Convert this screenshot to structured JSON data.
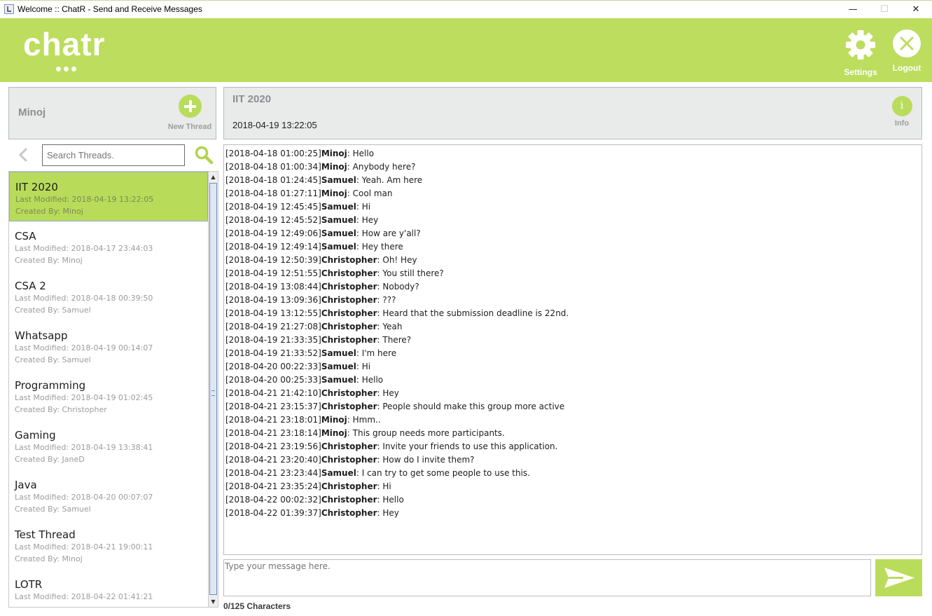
{
  "window": {
    "title": "Welcome :: ChatR - Send and Receive Messages",
    "minimize_glyph": "—",
    "maximize_glyph": "☐",
    "close_glyph": "✕"
  },
  "header": {
    "logo": "chatr",
    "settings_label": "Settings",
    "logout_label": "Logout",
    "accent_color": "#bcdd5d"
  },
  "user_panel": {
    "username": "Minoj",
    "new_thread_label": "New Thread"
  },
  "search": {
    "placeholder": "Search Threads."
  },
  "threads": [
    {
      "name": "IIT 2020",
      "modified": "Last Modified: 2018-04-19 13:22:05",
      "creator": "Created By: Minoj",
      "selected": true
    },
    {
      "name": "CSA",
      "modified": "Last Modified: 2018-04-17 23:44:03",
      "creator": "Created By: Minoj"
    },
    {
      "name": "CSA 2",
      "modified": "Last Modified: 2018-04-18 00:39:50",
      "creator": "Created By: Samuel"
    },
    {
      "name": "Whatsapp",
      "modified": "Last Modified: 2018-04-19 00:14:07",
      "creator": "Created By: Samuel"
    },
    {
      "name": "Programming",
      "modified": "Last Modified: 2018-04-19 01:02:45",
      "creator": "Created By: Christopher"
    },
    {
      "name": "Gaming",
      "modified": "Last Modified: 2018-04-19 13:38:41",
      "creator": "Created By: JaneD"
    },
    {
      "name": "Java",
      "modified": "Last Modified: 2018-04-20 00:07:07",
      "creator": "Created By: Samuel"
    },
    {
      "name": "Test Thread",
      "modified": "Last Modified: 2018-04-21 19:00:11",
      "creator": "Created By: Minoj"
    },
    {
      "name": "LOTR",
      "modified": "Last Modified: 2018-04-22 01:41:21",
      "creator": ""
    }
  ],
  "active_thread": {
    "title": "IIT 2020",
    "date": "2018-04-19 13:22:05",
    "info_label": "Info"
  },
  "messages": [
    {
      "time": "[2018-04-18 01:00:25]",
      "sender": "Minoj",
      "text": ": Hello"
    },
    {
      "time": "[2018-04-18 01:00:34]",
      "sender": "Minoj",
      "text": ": Anybody here?"
    },
    {
      "time": "[2018-04-18 01:24:45]",
      "sender": "Samuel",
      "text": ": Yeah. Am here"
    },
    {
      "time": "[2018-04-18 01:27:11]",
      "sender": "Minoj",
      "text": ": Cool man"
    },
    {
      "time": "[2018-04-19 12:45:45]",
      "sender": "Samuel",
      "text": ": Hi"
    },
    {
      "time": "[2018-04-19 12:45:52]",
      "sender": "Samuel",
      "text": ": Hey"
    },
    {
      "time": "[2018-04-19 12:49:06]",
      "sender": "Samuel",
      "text": ": How are y'all?"
    },
    {
      "time": "[2018-04-19 12:49:14]",
      "sender": "Samuel",
      "text": ": Hey there"
    },
    {
      "time": "[2018-04-19 12:50:39]",
      "sender": "Christopher",
      "text": ": Oh! Hey"
    },
    {
      "time": "[2018-04-19 12:51:55]",
      "sender": "Christopher",
      "text": ": You still there?"
    },
    {
      "time": "[2018-04-19 13:08:44]",
      "sender": "Christopher",
      "text": ": Nobody?"
    },
    {
      "time": "[2018-04-19 13:09:36]",
      "sender": "Christopher",
      "text": ": ???"
    },
    {
      "time": "[2018-04-19 13:12:55]",
      "sender": "Christopher",
      "text": ": Heard that the submission deadline is 22nd."
    },
    {
      "time": "[2018-04-19 21:27:08]",
      "sender": "Christopher",
      "text": ": Yeah"
    },
    {
      "time": "[2018-04-19 21:33:35]",
      "sender": "Christopher",
      "text": ": There?"
    },
    {
      "time": "[2018-04-19 21:33:52]",
      "sender": "Samuel",
      "text": ": I'm here"
    },
    {
      "time": "[2018-04-20 00:22:33]",
      "sender": "Samuel",
      "text": ": Hi"
    },
    {
      "time": "[2018-04-20 00:25:33]",
      "sender": "Samuel",
      "text": ": Hello"
    },
    {
      "time": "[2018-04-21 21:42:10]",
      "sender": "Christopher",
      "text": ": Hey"
    },
    {
      "time": "[2018-04-21 23:15:37]",
      "sender": "Christopher",
      "text": ": People should make this group more active"
    },
    {
      "time": "[2018-04-21 23:18:01]",
      "sender": "Minoj",
      "text": ": Hmm.."
    },
    {
      "time": "[2018-04-21 23:18:14]",
      "sender": "Minoj",
      "text": ": This group needs more participants."
    },
    {
      "time": "[2018-04-21 23:19:56]",
      "sender": "Christopher",
      "text": ": Invite your friends to use this application."
    },
    {
      "time": "[2018-04-21 23:20:40]",
      "sender": "Christopher",
      "text": ": How do I invite them?"
    },
    {
      "time": "[2018-04-21 23:23:44]",
      "sender": "Samuel",
      "text": ": I can try to get some people to use this."
    },
    {
      "time": "[2018-04-21 23:35:24]",
      "sender": "Christopher",
      "text": ": Hi"
    },
    {
      "time": "[2018-04-22 00:02:32]",
      "sender": "Christopher",
      "text": ": Hello"
    },
    {
      "time": "[2018-04-22 01:39:37]",
      "sender": "Christopher",
      "text": ": Hey"
    }
  ],
  "composer": {
    "placeholder": "Type your message here.",
    "char_count": "0/125 Characters"
  },
  "icons": {
    "app": "java-app-icon",
    "settings": "gear-icon",
    "logout": "close-circle-icon",
    "new_thread": "plus-circle-icon",
    "back": "chevron-left-icon",
    "search": "search-icon",
    "info": "info-icon",
    "send": "paper-plane-icon"
  }
}
